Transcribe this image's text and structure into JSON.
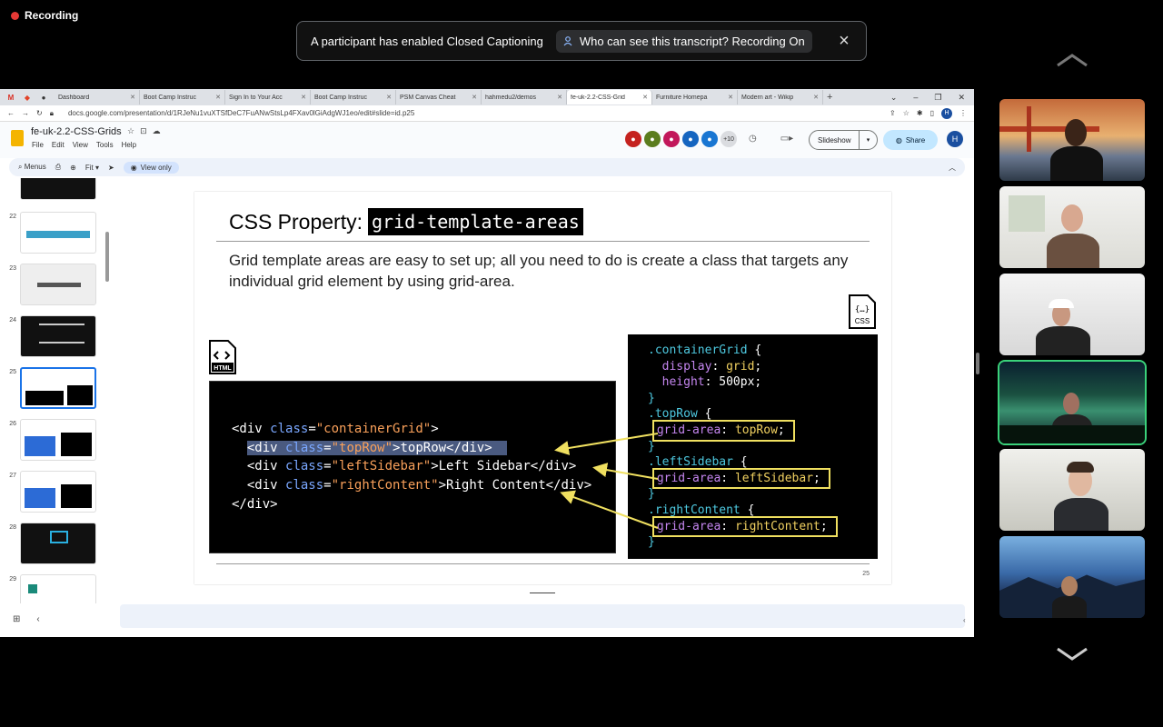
{
  "recording": {
    "label": "Recording"
  },
  "toast": {
    "message": "A participant has enabled Closed Captioning",
    "button_label": "Who can see this transcript? Recording On",
    "close_icon": "×"
  },
  "browser": {
    "tabs": [
      {
        "label": "Dashboard",
        "active": false
      },
      {
        "label": "Boot Camp Instruc",
        "active": false
      },
      {
        "label": "Sign In to Your Acc",
        "active": false
      },
      {
        "label": "Boot Camp Instruc",
        "active": false
      },
      {
        "label": "PSM Canvas Cheat",
        "active": false
      },
      {
        "label": "hahmedu2/demos",
        "active": false
      },
      {
        "label": "fe-uk-2.2-CSS-Grid",
        "active": true
      },
      {
        "label": "Furniture Homepa",
        "active": false
      },
      {
        "label": "Modern art - Wikip",
        "active": false
      }
    ],
    "url": "docs.google.com/presentation/d/1RJeNu1vuXTSfDeC7FuANwStsLp4FXav0lGiAdgWJ1eo/edit#slide=id.p25",
    "profile_initial": "H"
  },
  "docs": {
    "title": "fe-uk-2.2-CSS-Grids",
    "menu": [
      "File",
      "Edit",
      "View",
      "Tools",
      "Help"
    ],
    "avatar_more": "+10",
    "slideshow_label": "Slideshow",
    "share_label": "Share",
    "account_initial": "H",
    "toolbar": {
      "menus_label": "Menus",
      "zoom_label": "Fit",
      "view_only_label": "View only"
    }
  },
  "filmstrip": {
    "numbers": [
      "22",
      "23",
      "24",
      "25",
      "26",
      "27",
      "28",
      "29"
    ],
    "active_number": "25"
  },
  "slide": {
    "title_prefix": "CSS Property:",
    "title_code": "grid-template-areas",
    "body": "Grid template areas are easy to set up; all you need to do is create a class that targets any individual grid element by using grid-area.",
    "html_icon_label": "HTML",
    "css_icon_label": "CSS",
    "page_number": "25",
    "html_code": {
      "l1": {
        "open": "<div ",
        "attr": "class",
        "eq": "=",
        "val": "\"containerGrid\"",
        "close": ">"
      },
      "l2": {
        "indent": "  ",
        "open": "<div ",
        "attr": "class",
        "eq": "=",
        "val": "\"topRow\"",
        "close": ">topRow</div>"
      },
      "l3": {
        "indent": "  ",
        "open": "<div ",
        "attr": "class",
        "eq": "=",
        "val": "\"leftSidebar\"",
        "close": ">Left Sidebar</div>"
      },
      "l4": {
        "indent": "  ",
        "open": "<div ",
        "attr": "class",
        "eq": "=",
        "val": "\"rightContent\"",
        "close": ">Right Content</div>"
      },
      "l5": "</div>"
    },
    "css_code": {
      "sel1": ".containerGrid",
      "p1": "display",
      "v1": "grid",
      "p2": "height",
      "v2": "500px",
      "sel2": ".topRow",
      "p3": "grid-area",
      "v3": "topRow",
      "sel3": ".leftSidebar",
      "p4": "grid-area",
      "v4": "leftSidebar",
      "sel4": ".rightContent",
      "p5": "grid-area",
      "v5": "rightContent"
    }
  },
  "colors": {
    "accent": "#1a73e8",
    "active_speaker": "#3ad17a",
    "highlight_box": "#f0e060"
  }
}
